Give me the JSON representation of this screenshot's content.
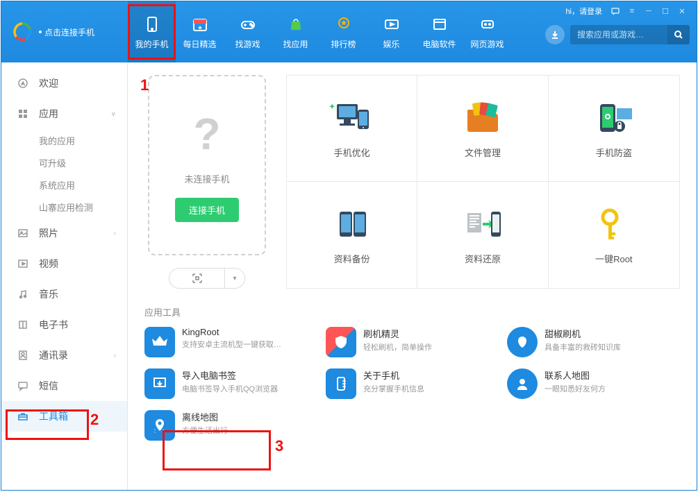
{
  "header": {
    "logo_text": "点击连接手机",
    "login_text": "hi，请登录",
    "tabs": [
      {
        "label": "我的手机"
      },
      {
        "label": "每日精选"
      },
      {
        "label": "找游戏"
      },
      {
        "label": "找应用"
      },
      {
        "label": "排行榜"
      },
      {
        "label": "娱乐"
      },
      {
        "label": "电脑软件"
      },
      {
        "label": "网页游戏"
      }
    ],
    "search_placeholder": "搜索应用或游戏…"
  },
  "sidebar": {
    "items": [
      {
        "label": "欢迎"
      },
      {
        "label": "应用",
        "expandable": true
      },
      {
        "label": "照片",
        "expandable": true
      },
      {
        "label": "视频"
      },
      {
        "label": "音乐"
      },
      {
        "label": "电子书"
      },
      {
        "label": "通讯录",
        "expandable": true
      },
      {
        "label": "短信"
      },
      {
        "label": "工具箱",
        "active": true
      }
    ],
    "app_subs": [
      {
        "label": "我的应用"
      },
      {
        "label": "可升级"
      },
      {
        "label": "系统应用"
      },
      {
        "label": "山寨应用检测"
      }
    ]
  },
  "phone_panel": {
    "not_connected": "未连接手机",
    "connect_btn": "连接手机"
  },
  "features": [
    {
      "label": "手机优化"
    },
    {
      "label": "文件管理"
    },
    {
      "label": "手机防盗"
    },
    {
      "label": "资料备份"
    },
    {
      "label": "资料还原"
    },
    {
      "label": "一键Root"
    }
  ],
  "tools_section_title": "应用工具",
  "tools": [
    {
      "title": "KingRoot",
      "desc": "支持安卓主流机型一键获取…"
    },
    {
      "title": "刷机精灵",
      "desc": "轻松刷机，简单操作"
    },
    {
      "title": "甜椒刷机",
      "desc": "具备丰富的救砖知识库"
    },
    {
      "title": "导入电脑书签",
      "desc": "电脑书签导入手机QQ浏览器"
    },
    {
      "title": "关于手机",
      "desc": "充分掌握手机信息"
    },
    {
      "title": "联系人地图",
      "desc": "一眼知悉好友何方"
    },
    {
      "title": "离线地图",
      "desc": "方便生活出行"
    }
  ],
  "annotations": {
    "a1": "1",
    "a2": "2",
    "a3": "3"
  }
}
